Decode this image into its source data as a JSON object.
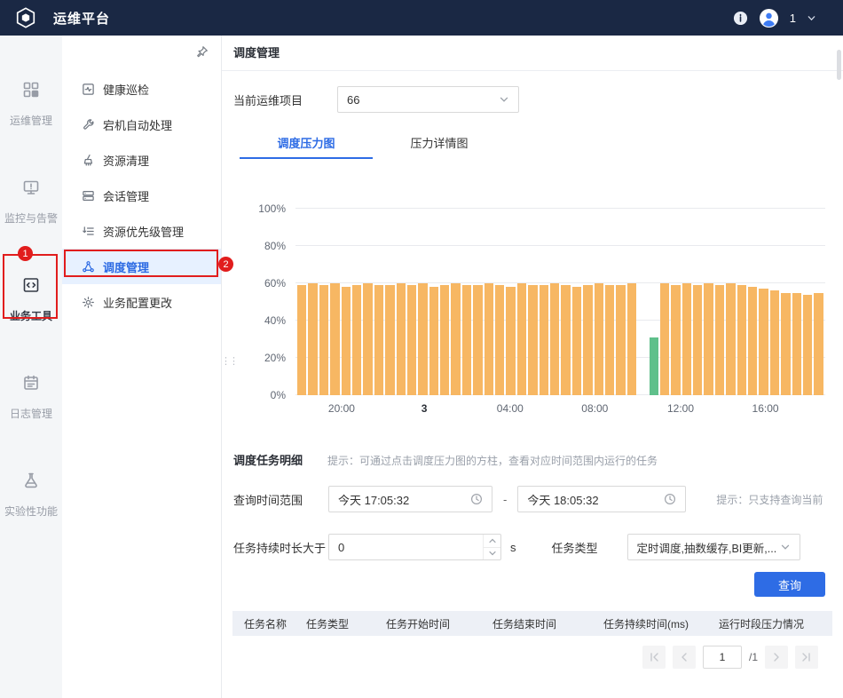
{
  "colors": {
    "topbar_bg": "#1a2844",
    "accent_blue": "#2e6ce5",
    "bar_orange": "#f7b763",
    "bar_green": "#5fc08b",
    "annotation_red": "#e11d1d",
    "submenu_selected_bg": "#e7f1ff",
    "table_header_bg": "#edf0f6"
  },
  "topbar": {
    "title": "运维平台",
    "username": "1"
  },
  "annotations": {
    "badge1": "1",
    "badge2": "2"
  },
  "sidebar": {
    "items": [
      {
        "label": "运维管理"
      },
      {
        "label": "监控与告警"
      },
      {
        "label": "业务工具"
      },
      {
        "label": "日志管理"
      },
      {
        "label": "实验性功能"
      }
    ]
  },
  "submenu": {
    "items": [
      {
        "label": "健康巡检"
      },
      {
        "label": "宕机自动处理"
      },
      {
        "label": "资源清理"
      },
      {
        "label": "会话管理"
      },
      {
        "label": "资源优先级管理"
      },
      {
        "label": "调度管理"
      },
      {
        "label": "业务配置更改"
      }
    ]
  },
  "main": {
    "page_title": "调度管理",
    "project": {
      "label": "当前运维项目",
      "value": "66"
    },
    "tabs": [
      {
        "label": "调度压力图"
      },
      {
        "label": "压力详情图"
      }
    ],
    "detail": {
      "title": "调度任务明细",
      "hint": "提示：可通过点击调度压力图的方柱，查看对应时间范围内运行的任务",
      "time_label": "查询时间范围",
      "time_start": "今天 17:05:32",
      "time_sep": "-",
      "time_end": "今天 18:05:32",
      "time_hint": "提示：只支持查询当前",
      "duration_label": "任务持续时长大于",
      "duration_value": "0",
      "duration_unit": "s",
      "type_label": "任务类型",
      "type_value": "定时调度,抽数缓存,BI更新,...",
      "query_button": "查询"
    },
    "table": {
      "columns": [
        "任务名称",
        "任务类型",
        "任务开始时间",
        "任务结束时间",
        "任务持续时间(ms)",
        "运行时段压力情况"
      ]
    },
    "pagination": {
      "page": "1",
      "total": "/1"
    }
  },
  "chart_data": {
    "type": "bar",
    "title": "调度压力图",
    "xlabel": "",
    "ylabel": "",
    "ylim": [
      0,
      100
    ],
    "grid": true,
    "legend": false,
    "ytick_labels": [
      "0%",
      "20%",
      "40%",
      "60%",
      "80%",
      "100%"
    ],
    "xticks": [
      {
        "label": "20:00",
        "pos": 0.087,
        "bold": false
      },
      {
        "label": "3",
        "pos": 0.243,
        "bold": true
      },
      {
        "label": "04:00",
        "pos": 0.405,
        "bold": false
      },
      {
        "label": "08:00",
        "pos": 0.565,
        "bold": false
      },
      {
        "label": "12:00",
        "pos": 0.727,
        "bold": false
      },
      {
        "label": "16:00",
        "pos": 0.887,
        "bold": false
      }
    ],
    "bar_color": "#f7b763",
    "highlight_color": "#5fc08b",
    "highlight_index": 32,
    "values": [
      59,
      60,
      59,
      60,
      58,
      59,
      60,
      59,
      59,
      60,
      59,
      60,
      58,
      59,
      60,
      59,
      59,
      60,
      59,
      58,
      60,
      59,
      59,
      60,
      59,
      58,
      59,
      60,
      59,
      59,
      60,
      0,
      31,
      60,
      59,
      60,
      59,
      60,
      59,
      60,
      59,
      58,
      57,
      56,
      55,
      55,
      54,
      55
    ]
  }
}
